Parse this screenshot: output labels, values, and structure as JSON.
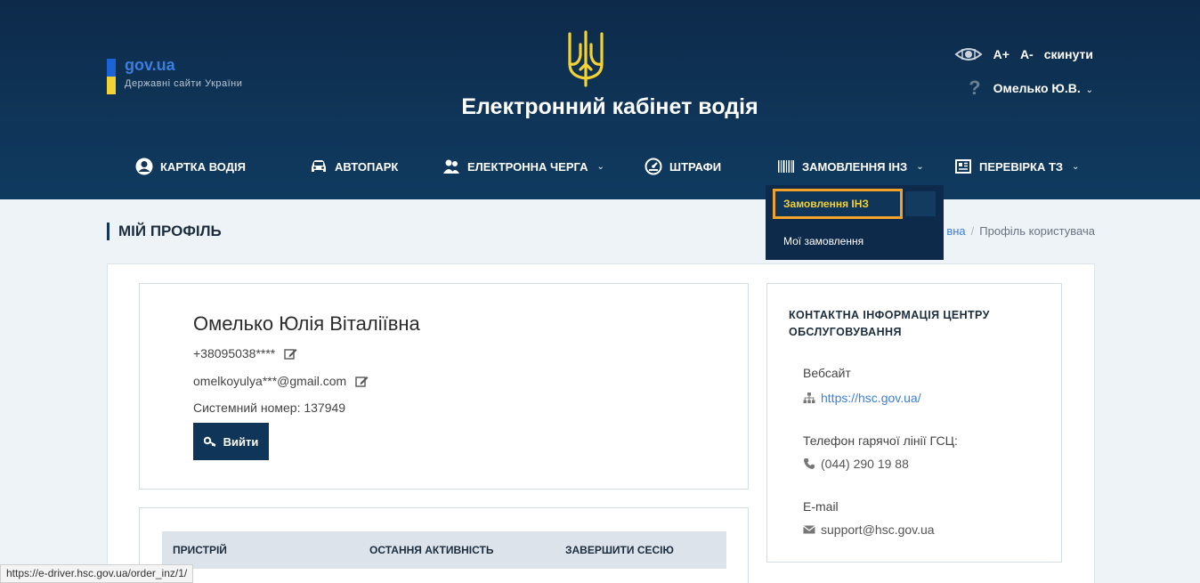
{
  "gov": {
    "name": "gov.ua",
    "subtitle": "Державні сайти України"
  },
  "site_title": "Електронний кабінет водія",
  "accessibility": {
    "increase": "A+",
    "decrease": "A-",
    "reset": "скинути"
  },
  "user": {
    "name": "Омелько Ю.В.",
    "help_symbol": "?"
  },
  "nav": {
    "items": [
      {
        "label": "Картка водія",
        "icon": "user-circle-icon"
      },
      {
        "label": "Автопарк",
        "icon": "car-icon"
      },
      {
        "label": "Електронна черга",
        "icon": "queue-icon"
      },
      {
        "label": "Штрафи",
        "icon": "speedometer-icon"
      },
      {
        "label": "Замовлення ІНЗ",
        "icon": "barcode-icon"
      },
      {
        "label": "Перевірка ТЗ",
        "icon": "newspaper-icon"
      }
    ],
    "dropdown": [
      "Замовлення ІНЗ",
      "Мої замовлення"
    ]
  },
  "page": {
    "title": "МІЙ ПРОФІЛЬ",
    "breadcrumb": {
      "partial_link": "вна",
      "current": "Профіль користувача",
      "separator": "/"
    }
  },
  "profile": {
    "full_name": "Омелько Юлія Віталіївна",
    "phone": "+38095038****",
    "email": "omelkoyulya***@gmail.com",
    "system_number": "Системний номер: 137949",
    "logout_label": "Вийти"
  },
  "sessions": {
    "columns": [
      "Пристрій",
      "Остання активність",
      "Завершити сесію"
    ]
  },
  "contact": {
    "title": "Контактна інформація центру обслуговування",
    "website_label": "Вебсайт",
    "website": "https://hsc.gov.ua/",
    "phone_label": "Телефон гарячої лінії ГСЦ:",
    "phone": "(044) 290 19 88",
    "email_label": "E-mail",
    "email": "support@hsc.gov.ua"
  },
  "statusbar": {
    "url": "https://e-driver.hsc.gov.ua/order_inz/1/"
  },
  "colors": {
    "header_bg": "#0f3558",
    "accent_yellow": "#f5d233",
    "highlight": "#f0a22a",
    "link": "#3b7ee0"
  }
}
